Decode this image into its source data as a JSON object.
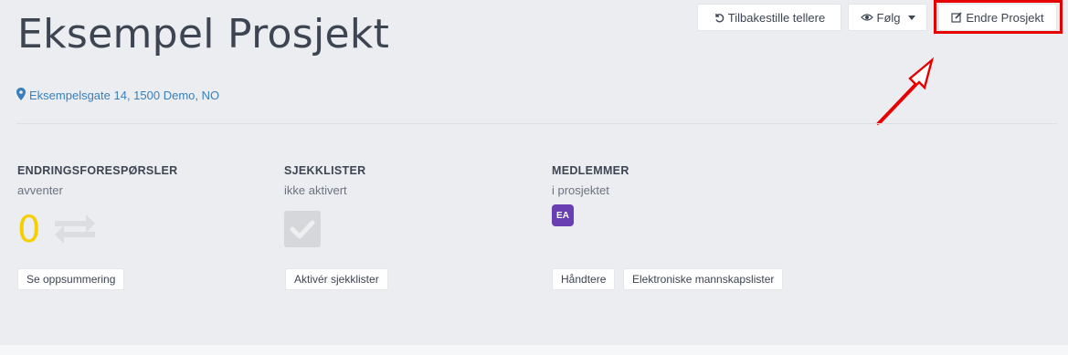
{
  "project": {
    "title": "Eksempel Prosjekt",
    "address": "Eksempelsgate 14, 1500 Demo, NO"
  },
  "header": {
    "reset_label": "Tilbakestille tellere",
    "follow_label": "Følg",
    "edit_label": "Endre Prosjekt"
  },
  "sections": {
    "change_requests": {
      "title": "ENDRINGSFORESPØRSLER",
      "subtitle": "avventer",
      "count": "0",
      "button": "Se oppsummering"
    },
    "checklists": {
      "title": "SJEKKLISTER",
      "subtitle": "ikke aktivert",
      "button": "Aktivér sjekklister"
    },
    "members": {
      "title": "MEDLEMMER",
      "subtitle": "i prosjektet",
      "avatar_initials": "EA",
      "buttons": [
        "Håndtere",
        "Elektroniske mannskapslister"
      ]
    }
  },
  "colors": {
    "background": "#ecedf0",
    "link": "#3a7fb9",
    "count": "#f5cf00",
    "avatar": "#6a3eb3",
    "annotation": "#e60000"
  },
  "icons": {
    "reset": "undo-icon",
    "follow": "eye-icon",
    "dropdown": "caret-down-icon",
    "edit": "edit-icon",
    "address": "map-pin-icon",
    "change_requests": "swap-arrows-icon",
    "checklists": "checkbox-icon"
  }
}
